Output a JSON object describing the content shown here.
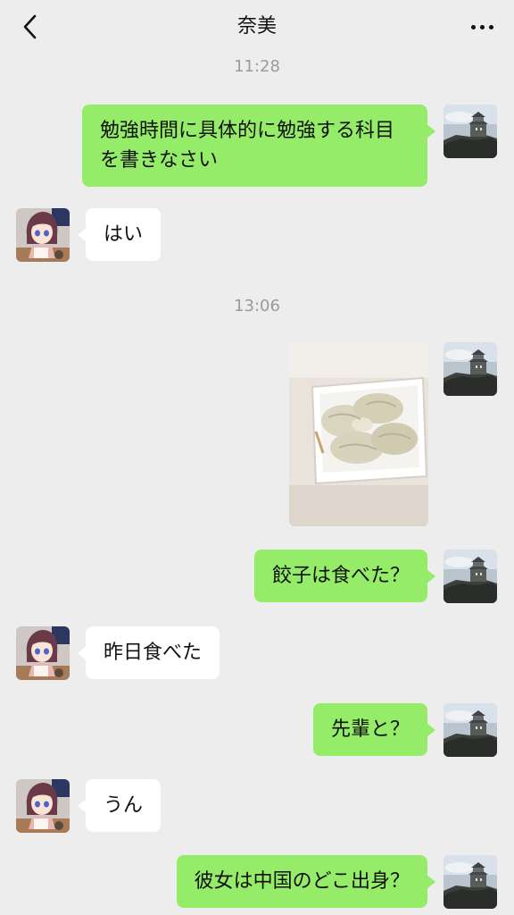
{
  "header": {
    "title": "奈美",
    "back_icon": "chevron-left-icon",
    "more_icon": "more-dots-icon"
  },
  "timestamps": [
    "11:28",
    "13:06"
  ],
  "messages": [
    {
      "side": "mine",
      "text": "勉強時間に具体的に勉強する科目を書きなさい"
    },
    {
      "side": "theirs",
      "text": "はい"
    },
    {
      "side": "mine",
      "type": "image",
      "content": "photo of dumplings on a white plate"
    },
    {
      "side": "mine",
      "text": "餃子は食べた？"
    },
    {
      "side": "theirs",
      "text": "昨日食べた"
    },
    {
      "side": "mine",
      "text": "先輩と？"
    },
    {
      "side": "theirs",
      "text": "うん"
    },
    {
      "side": "mine",
      "text": "彼女は中国のどこ出身？"
    }
  ],
  "colors": {
    "background": "#ededed",
    "my_bubble": "#95ec69",
    "their_bubble": "#ffffff",
    "timestamp": "#9a9a9a"
  }
}
